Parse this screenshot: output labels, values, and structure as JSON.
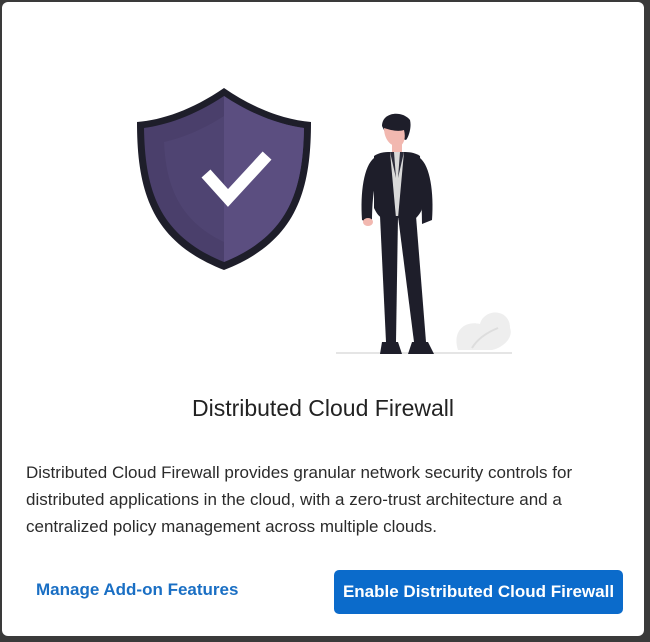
{
  "dialog": {
    "title": "Distributed Cloud Firewall",
    "description": "Distributed Cloud Firewall provides granular network security controls for distributed applications in the cloud, with a zero-trust architecture and a centralized policy management across multiple clouds.",
    "manage_link_label": "Manage Add-on Features",
    "enable_button_label": "Enable Distributed Cloud Firewall"
  },
  "illustration": {
    "shield_color": "#4a3f6b",
    "shield_light_color": "#5b4e80",
    "checkmark_color": "#ffffff",
    "person_suit_color": "#1e1e2a",
    "person_skin_color": "#f2b8b0",
    "person_hair_color": "#1e1e2a",
    "person_shirt_color": "#d9d9d9",
    "ground_color": "#e5e5e5",
    "plant_color": "#eeeeee"
  },
  "colors": {
    "link": "#1a6fc4",
    "primary_button": "#0b6bcb",
    "backdrop": "#3a3a3a"
  }
}
